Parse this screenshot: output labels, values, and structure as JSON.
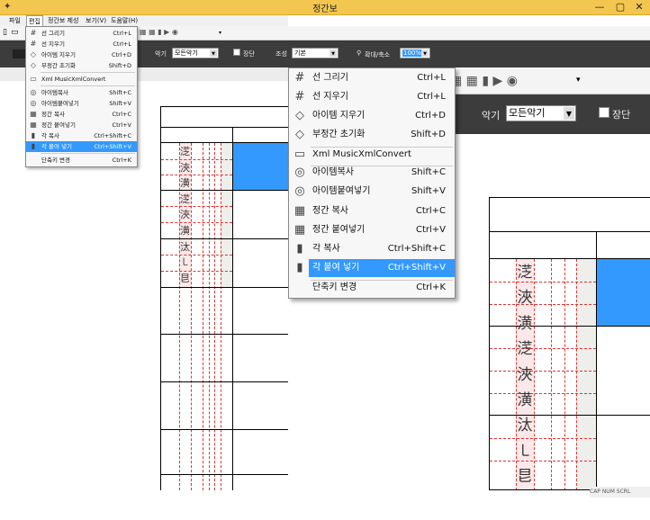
{
  "window": {
    "title": "정간보"
  },
  "menubar": [
    "파일",
    "편집",
    "정간보 제성",
    "보기(V)",
    "도움말(H)"
  ],
  "toolbar_small": {
    "instrument_label": "악기",
    "instrument_value": "모든악기",
    "jangdan_label": "장단",
    "key_label": "조성",
    "key_value": "기본",
    "zoom_label": "확대/축소",
    "zoom_value": "100%"
  },
  "toolbar_big": {
    "instrument_label": "악기",
    "instrument_value": "모든악기",
    "jangdan_label": "장단"
  },
  "edit_menu": [
    {
      "icon": "grid-icon",
      "glyph": "#",
      "label": "선 그리기",
      "shortcut": "Ctrl+L"
    },
    {
      "icon": "grid-erase-icon",
      "glyph": "#",
      "label": "선 지우기",
      "shortcut": "Ctrl+L"
    },
    {
      "icon": "eraser-icon",
      "glyph": "◇",
      "label": "아이템 지우기",
      "shortcut": "Ctrl+D"
    },
    {
      "icon": "reset-icon",
      "glyph": "◇",
      "label": "부정간 초기화",
      "shortcut": "Shift+D"
    },
    {
      "icon": "xml-icon",
      "glyph": "▭",
      "label": "Xml MusicXmlConvert",
      "shortcut": ""
    },
    {
      "icon": "copy-item-icon",
      "glyph": "◎",
      "label": "아이템복사",
      "shortcut": "Shift+C"
    },
    {
      "icon": "paste-item-icon",
      "glyph": "◎",
      "label": "아이템붙여넣기",
      "shortcut": "Shift+V"
    },
    {
      "icon": "copy-cell-icon",
      "glyph": "▦",
      "label": "정간 복사",
      "shortcut": "Ctrl+C"
    },
    {
      "icon": "paste-cell-icon",
      "glyph": "▦",
      "label": "정간 붙여넣기",
      "shortcut": "Ctrl+V"
    },
    {
      "icon": "copy-column-icon",
      "glyph": "▮",
      "label": "각 복사",
      "shortcut": "Ctrl+Shift+C"
    },
    {
      "icon": "paste-column-icon",
      "glyph": "▮",
      "label": "각 붙여 넣기",
      "shortcut": "Ctrl+Shift+V"
    },
    {
      "icon": "",
      "glyph": "",
      "label": "단축키 변경",
      "shortcut": "Ctrl+K"
    }
  ],
  "notes": {
    "small_col": [
      "㴀",
      "浹",
      "潢",
      "㴀",
      "浹",
      "潢",
      "汰",
      "㇄",
      "㫐"
    ],
    "big_col": [
      "㴀",
      "浹",
      "潢",
      "㴀",
      "浹",
      "潢",
      "汰",
      "㇄",
      "㫐"
    ]
  },
  "status": {
    "text": "CAP NUM SCRL"
  },
  "colors": {
    "titlebar": "#f3c64f",
    "selection": "#3399ff",
    "toolbar_dark": "#3c3c3c"
  }
}
